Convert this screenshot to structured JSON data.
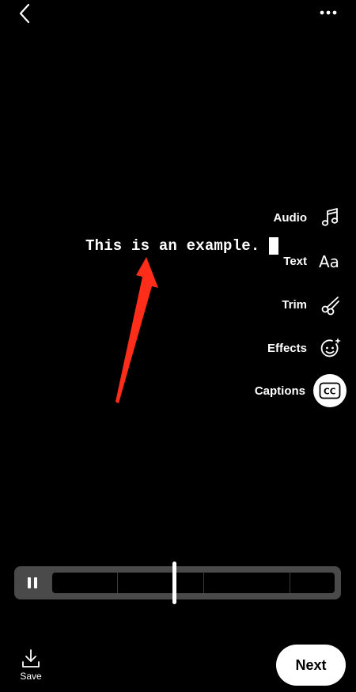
{
  "caption": {
    "text": "This is an example."
  },
  "tools": [
    {
      "label": "Audio",
      "icon": "music-note-icon"
    },
    {
      "label": "Text",
      "icon": "text-aa-icon"
    },
    {
      "label": "Trim",
      "icon": "scissors-icon"
    },
    {
      "label": "Effects",
      "icon": "sparkle-face-icon"
    },
    {
      "label": "Captions",
      "icon": "cc-icon",
      "active": true
    }
  ],
  "bottom": {
    "save_label": "Save",
    "next_label": "Next"
  },
  "colors": {
    "background": "#000000",
    "arrow": "#ff2d1a",
    "timeline": "#4a4a4a"
  }
}
